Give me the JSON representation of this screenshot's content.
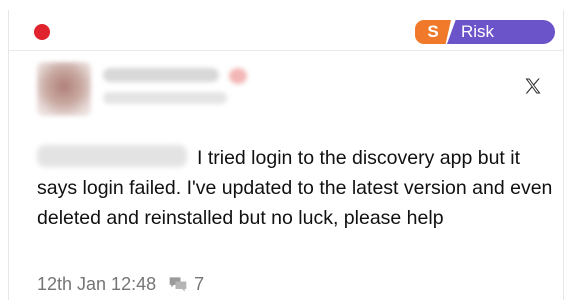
{
  "header": {
    "status_color": "#e0232c",
    "source_badge": "S",
    "source_badge_color": "#f07a2a",
    "category_label": "Risk",
    "category_color": "#6b54c9"
  },
  "author": {
    "avatar_icon": "user-avatar",
    "platform_icon": "x-logo-icon"
  },
  "post": {
    "text": "I tried login to the discovery app but it says login failed. I've updated to the latest version and even deleted and reinstalled but no luck, please help",
    "timestamp": "12th Jan 12:48",
    "comment_icon": "comment-icon",
    "comment_count": "7"
  }
}
